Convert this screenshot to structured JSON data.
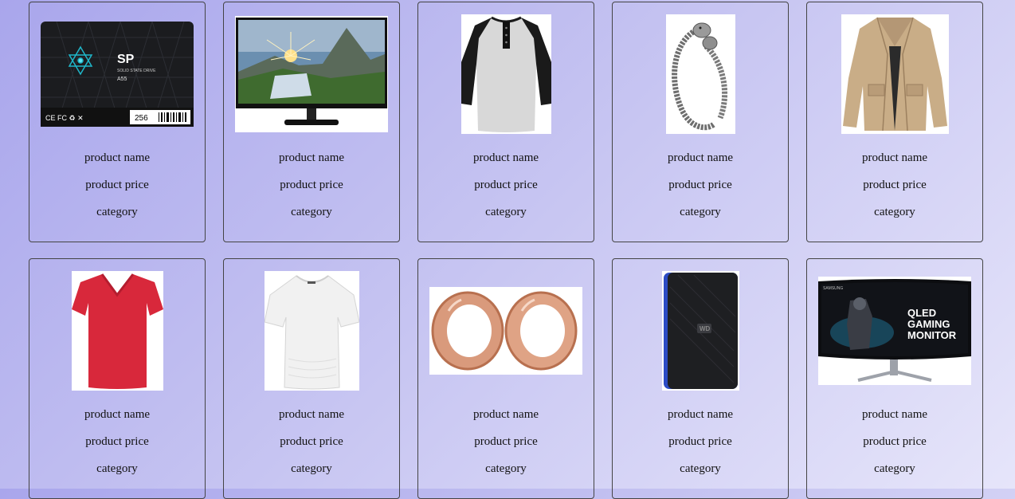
{
  "products": [
    {
      "name": "product name",
      "price": "product price",
      "category": "category",
      "image": "ssd-drive-image",
      "image_text": [
        "SP",
        "SOLID STATE DRIVE",
        "A55",
        "256"
      ]
    },
    {
      "name": "product name",
      "price": "product price",
      "category": "category",
      "image": "monitor-image"
    },
    {
      "name": "product name",
      "price": "product price",
      "category": "category",
      "image": "raglan-shirt-image"
    },
    {
      "name": "product name",
      "price": "product price",
      "category": "category",
      "image": "bracelet-image"
    },
    {
      "name": "product name",
      "price": "product price",
      "category": "category",
      "image": "jacket-image"
    },
    {
      "name": "product name",
      "price": "product price",
      "category": "category",
      "image": "red-tshirt-image"
    },
    {
      "name": "product name",
      "price": "product price",
      "category": "category",
      "image": "white-top-image"
    },
    {
      "name": "product name",
      "price": "product price",
      "category": "category",
      "image": "rose-gold-plugs-image"
    },
    {
      "name": "product name",
      "price": "product price",
      "category": "category",
      "image": "external-hdd-image"
    },
    {
      "name": "product name",
      "price": "product price",
      "category": "category",
      "image": "curved-monitor-image",
      "image_text": [
        "SAMSUNG",
        "QLED",
        "GAMING",
        "MONITOR"
      ]
    }
  ]
}
